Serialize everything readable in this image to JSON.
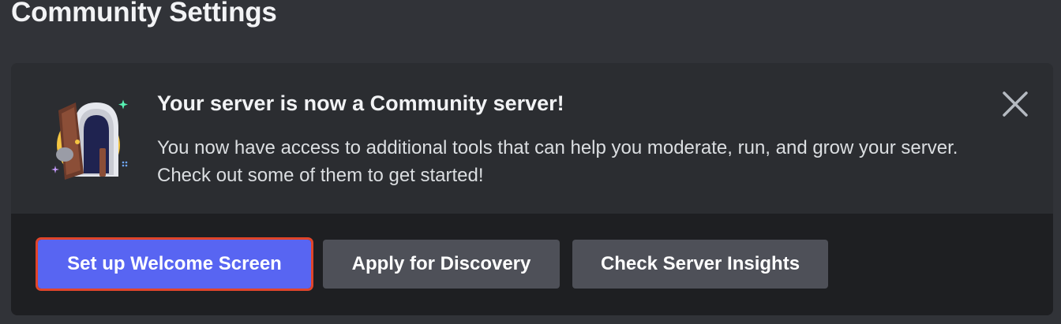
{
  "page": {
    "title": "Community Settings"
  },
  "banner": {
    "headline": "Your server is now a Community server!",
    "description": "You now have access to additional tools that can help you moderate, run, and grow your server. Check out some of them to get started!",
    "illustration_icon": "community-door-icon",
    "close_icon": "close-icon"
  },
  "actions": {
    "welcome_screen_label": "Set up Welcome Screen",
    "discovery_label": "Apply for Discovery",
    "insights_label": "Check Server Insights"
  },
  "colors": {
    "background": "#313338",
    "card": "#2b2d31",
    "card_footer": "#1e1f22",
    "primary_button": "#5865f2",
    "secondary_button": "#4e5058",
    "highlight_outline": "#e0452b"
  }
}
